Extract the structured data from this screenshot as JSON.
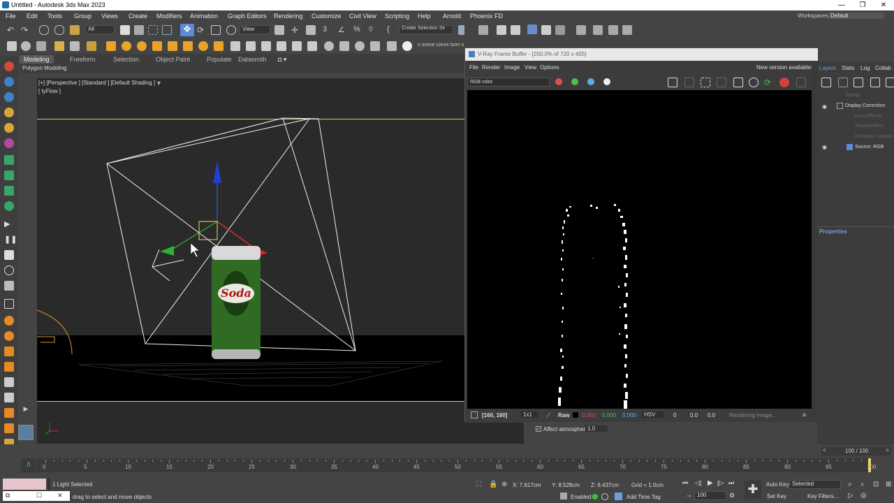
{
  "window": {
    "title": "Untitled - Autodesk 3ds Max 2023",
    "workspaces_label": "Workspaces:",
    "workspace": "Default"
  },
  "menu": [
    "File",
    "Edit",
    "Tools",
    "Group",
    "Views",
    "Create",
    "Modifiers",
    "Animation",
    "Graph Editors",
    "Rendering",
    "Customize",
    "Civil View",
    "Scripting",
    "Help",
    "Arnold",
    "Phoenix FD"
  ],
  "toolbar": {
    "filter": "All",
    "ref_coord": "View",
    "selection_set": "Create Selection Se",
    "script_text": "n scene convx torm scene list Storm RT mod"
  },
  "ribbon": {
    "tabs": [
      "Modeling",
      "Freeform",
      "Selection",
      "Object Paint",
      "Populate",
      "Datasmith"
    ],
    "sub": "Polygon Modeling"
  },
  "viewport": {
    "label": "[+] [Perspective ] [Standard ] [Default Shading ]",
    "sublabel": "[ tyFlow ]",
    "can_text": "Soda"
  },
  "vfb": {
    "title": "V-Ray Frame Buffer - [200.0% of 720 x 405]",
    "menu": [
      "File",
      "Render",
      "Image",
      "View",
      "Options"
    ],
    "new_version": "New version available!",
    "channel": "RGB color",
    "coords": "[160, 160]",
    "zoom": "1x1",
    "raw": "Raw",
    "r": "0.000",
    "g": "0.000",
    "b": "0.000",
    "mode": "HSV",
    "h": "0",
    "s": "0.0",
    "v": "0.0",
    "status": "Rendering image..."
  },
  "layers": {
    "tabs": [
      "Layers",
      "Stats",
      "Log",
      "Collab"
    ],
    "items": [
      "Stamp",
      "Display Correction",
      "Lens Effects",
      "Sharpen/Blur",
      "Denoiser: unavail",
      "Source: RGB"
    ],
    "properties": "Properties"
  },
  "atmos": {
    "label": "Affect atmospheric",
    "value": "1.0"
  },
  "status": {
    "selected": "1 Light Selected",
    "prompt": "drag to select and move objects",
    "x": "X: 7.617cm",
    "y": "Y: 8.528cm",
    "z": "Z: 6.437cm",
    "grid": "Grid = 1.0cm",
    "enabled": "Enabled:",
    "add_time_tag": "Add Time Tag",
    "frame": "100 / 100",
    "auto_key": "Auto Key",
    "set_key": "Set Key",
    "selected_dd": "Selected",
    "key_filters": "Key Filters...",
    "frame_field": "100"
  },
  "timeline": {
    "ticks": [
      "0",
      "5",
      "10",
      "15",
      "20",
      "25",
      "30",
      "35",
      "40",
      "45",
      "50",
      "55",
      "60",
      "65",
      "70",
      "75",
      "80",
      "85",
      "90",
      "95",
      "100"
    ]
  },
  "colors": {
    "accent": "#5b8bd4",
    "frame_red": "#ff3030",
    "bg": "#444444"
  }
}
